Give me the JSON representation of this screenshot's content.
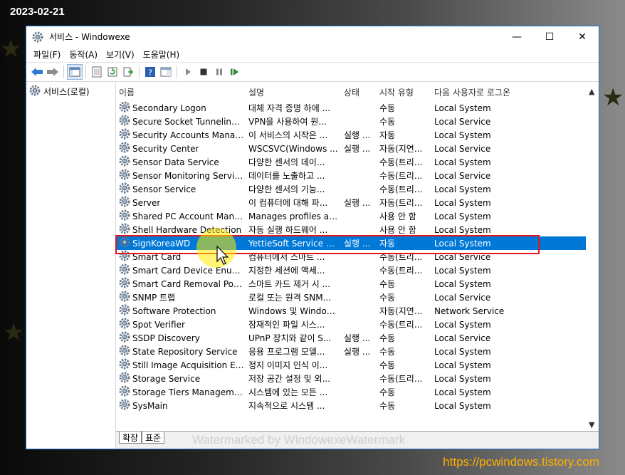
{
  "overlay": {
    "date": "2023-02-21",
    "site": "https://pcwindows.tistory.com",
    "watermark": "Watermarked by WindowexeWatermark"
  },
  "window": {
    "title": "서비스   - Windowexe",
    "controls": {
      "minimize": "—",
      "maximize": "☐",
      "close": "✕"
    }
  },
  "menu": [
    "파일(F)",
    "동작(A)",
    "보기(V)",
    "도움말(H)"
  ],
  "tree": {
    "root": "서비스(로컬)"
  },
  "columns": {
    "name": "이름",
    "desc": "설명",
    "status": "상태",
    "start": "시작 유형",
    "logon": "다음 사용자로 로그온"
  },
  "services": [
    {
      "name": "Secondary Logon",
      "desc": "대체 자격 증명 하에 ...",
      "status": "",
      "start": "수동",
      "logon": "Local System"
    },
    {
      "name": "Secure Socket Tunneling P...",
      "desc": "VPN을 사용하여 원...",
      "status": "",
      "start": "수동",
      "logon": "Local Service"
    },
    {
      "name": "Security Accounts Manager",
      "desc": "이 서비스의 시작은 ...",
      "status": "실행 ...",
      "start": "자동",
      "logon": "Local System"
    },
    {
      "name": "Security Center",
      "desc": "WSCSVC(Windows ...",
      "status": "실행 ...",
      "start": "자동(지연...",
      "logon": "Local Service"
    },
    {
      "name": "Sensor Data Service",
      "desc": "다양한 센서의 데이...",
      "status": "",
      "start": "수동(트리...",
      "logon": "Local System"
    },
    {
      "name": "Sensor Monitoring Service",
      "desc": "데이터를 노출하고 ...",
      "status": "",
      "start": "수동(트리...",
      "logon": "Local Service"
    },
    {
      "name": "Sensor Service",
      "desc": "다양한 센서의 기능...",
      "status": "",
      "start": "수동(트리...",
      "logon": "Local System"
    },
    {
      "name": "Server",
      "desc": "이 컴퓨터에 대해 파...",
      "status": "실행 ...",
      "start": "자동(트리...",
      "logon": "Local System"
    },
    {
      "name": "Shared PC Account Manager",
      "desc": "Manages profiles an...",
      "status": "",
      "start": "사용 안 함",
      "logon": "Local System"
    },
    {
      "name": "Shell Hardware Detection",
      "desc": "자동 실행 하드웨어 ...",
      "status": "",
      "start": "사용 안 함",
      "logon": "Local System"
    },
    {
      "name": "SignKoreaWD",
      "desc": "YettieSoft Service Da...",
      "status": "실행 ...",
      "start": "자동",
      "logon": "Local System"
    },
    {
      "name": "Smart Card",
      "desc": "컴퓨터에서 스마트 ...",
      "status": "",
      "start": "수동(트리...",
      "logon": "Local Service"
    },
    {
      "name": "Smart Card Device Enumer...",
      "desc": "지정한 세션에 액세...",
      "status": "",
      "start": "수동(트리...",
      "logon": "Local System"
    },
    {
      "name": "Smart Card Removal Policy",
      "desc": "스마트 카드 제거 시 ...",
      "status": "",
      "start": "수동",
      "logon": "Local System"
    },
    {
      "name": "SNMP 트랩",
      "desc": "로컬 또는 원격 SNM...",
      "status": "",
      "start": "수동",
      "logon": "Local Service"
    },
    {
      "name": "Software Protection",
      "desc": "Windows 및 Window...",
      "status": "",
      "start": "자동(지연...",
      "logon": "Network Service"
    },
    {
      "name": "Spot Verifier",
      "desc": "잠재적인 파일 시스...",
      "status": "",
      "start": "수동(트리...",
      "logon": "Local System"
    },
    {
      "name": "SSDP Discovery",
      "desc": "UPnP 장치와 같이 S...",
      "status": "실행 ...",
      "start": "수동",
      "logon": "Local Service"
    },
    {
      "name": "State Repository Service",
      "desc": "응용 프로그램 모델...",
      "status": "실행 ...",
      "start": "수동",
      "logon": "Local System"
    },
    {
      "name": "Still Image Acquisition Eve...",
      "desc": "정지 이미지 인식 이...",
      "status": "",
      "start": "수동",
      "logon": "Local System"
    },
    {
      "name": "Storage Service",
      "desc": "저장 공간 설정 및 외...",
      "status": "",
      "start": "수동(트리...",
      "logon": "Local System"
    },
    {
      "name": "Storage Tiers Management",
      "desc": "시스템에 있는 모든 ...",
      "status": "",
      "start": "수동",
      "logon": "Local System"
    },
    {
      "name": "SysMain",
      "desc": "지속적으로 시스템 ...",
      "status": "",
      "start": "수동",
      "logon": "Local System"
    }
  ],
  "selected_index": 10,
  "tabs": [
    "확장",
    "표준"
  ],
  "colors": {
    "selection": "#0078d7",
    "highlight": "#e8141a",
    "site": "#ffb000"
  }
}
